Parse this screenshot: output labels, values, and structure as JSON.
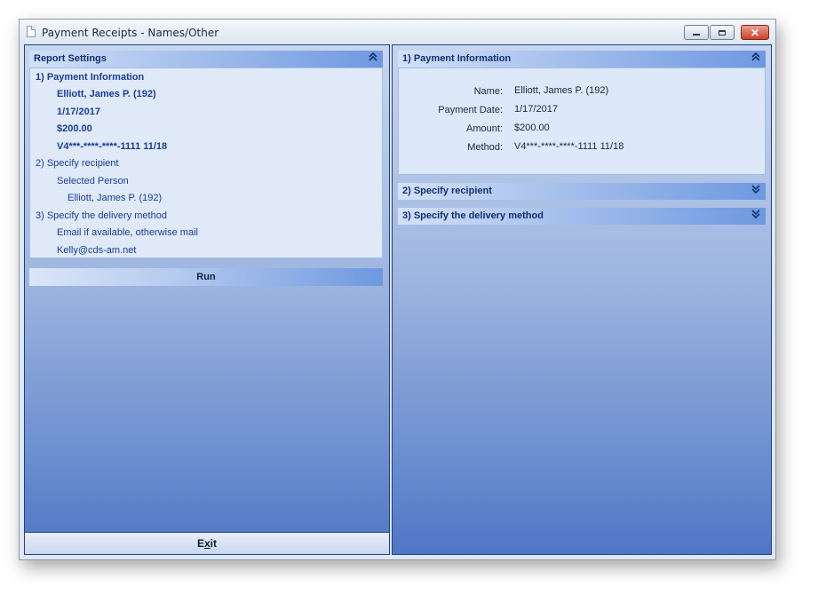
{
  "window": {
    "title": "Payment Receipts - Names/Other",
    "controls": {
      "minimize": "minimize",
      "maximize": "maximize",
      "close": "✕"
    }
  },
  "left": {
    "header": "Report Settings",
    "tree": {
      "payment_info": "1)  Payment Information",
      "name": "Elliott, James P. (192)",
      "date": "1/17/2017",
      "amount": "$200.00",
      "method": "V4***-****-****-1111 11/18",
      "recipient_step": "2)  Specify recipient",
      "selected_person": "Selected Person",
      "recipient_name": "Elliott, James P. (192)",
      "delivery_step": "3)  Specify the delivery method",
      "delivery_method": "Email if available, otherwise mail",
      "email": "Kelly@cds-am.net"
    },
    "run_label": "Run",
    "exit_label_prefix": "E",
    "exit_label_underline": "x",
    "exit_label_suffix": "it"
  },
  "right": {
    "payment_header": "1)  Payment Information",
    "fields": {
      "name_label": "Name:",
      "name_value": "Elliott, James P. (192)",
      "date_label": "Payment Date:",
      "date_value": "1/17/2017",
      "amount_label": "Amount:",
      "amount_value": "$200.00",
      "method_label": "Method:",
      "method_value": "V4***-****-****-1111 11/18"
    },
    "recipient_header": "2)  Specify recipient",
    "delivery_header": "3)  Specify the delivery method"
  },
  "icons": {
    "collapse": "⌃⌃",
    "expand": "⌄⌄"
  }
}
